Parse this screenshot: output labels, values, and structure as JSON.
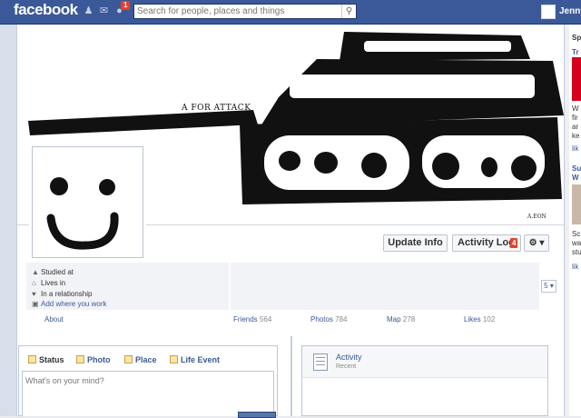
{
  "topbar": {
    "logo": "facebook",
    "notification_count": "1",
    "search_placeholder": "Search for people, places and things",
    "user_name": "Jenny"
  },
  "cover": {
    "caption": "A FOR ATTACK",
    "signature": "A.EON"
  },
  "actions": {
    "update_info": "Update Info",
    "activity_log": "Activity Log",
    "activity_log_count": "4",
    "settings": "⚙ ▾"
  },
  "about": {
    "items": [
      {
        "icon": "graduation-cap-icon",
        "text": "Studied at"
      },
      {
        "icon": "home-icon",
        "text": "Lives in"
      },
      {
        "icon": "heart-icon",
        "text": "In a relationship"
      },
      {
        "icon": "briefcase-icon",
        "text": "Add where you work"
      }
    ],
    "link": "About"
  },
  "apps_dropdown": "5 ▾",
  "tabs": [
    {
      "label": "Friends",
      "count": "564"
    },
    {
      "label": "Photos",
      "count": "784"
    },
    {
      "label": "Map",
      "count": "278"
    },
    {
      "label": "Likes",
      "count": "102"
    }
  ],
  "composer": {
    "tabs": [
      "Status",
      "Photo",
      "Place",
      "Life Event"
    ],
    "placeholder": "What's on your mind?"
  },
  "activity": {
    "title": "Activity",
    "subtitle": "Recent"
  },
  "sidebar_right": {
    "items": [
      "Sp",
      "Tr",
      "W",
      "fir",
      "ar",
      "ke",
      "lik",
      "Su",
      "W",
      "Sc",
      "wa",
      "stu",
      "lik"
    ]
  },
  "colors": {
    "brand": "#3b5998",
    "badge": "#f03d25"
  }
}
